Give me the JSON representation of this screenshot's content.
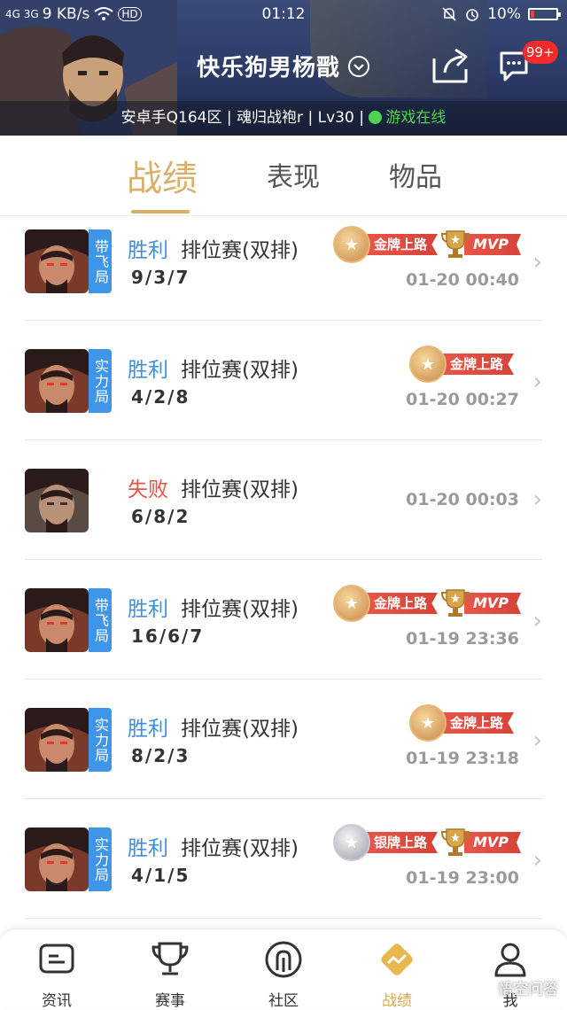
{
  "status_bar": {
    "network": "4G 3G",
    "speed": "9 KB/s",
    "hd": "HD",
    "time": "01:12",
    "battery": "10%"
  },
  "header": {
    "player_name": "快乐狗男杨戬",
    "server": "安卓手Q164区",
    "rank": "魂归战袍r",
    "level": "Lv30",
    "online_status": "游戏在线",
    "message_badge": "99+"
  },
  "tabs": [
    {
      "label": "战绩",
      "active": true
    },
    {
      "label": "表现",
      "active": false
    },
    {
      "label": "物品",
      "active": false
    }
  ],
  "matches": [
    {
      "tag": "带飞局",
      "result": "胜利",
      "mode": "排位赛(双排)",
      "kda": "9/3/7",
      "time": "01-20 00:40",
      "medal": "金牌上路",
      "medal_type": "gold",
      "mvp": "MVP"
    },
    {
      "tag": "实力局",
      "result": "胜利",
      "mode": "排位赛(双排)",
      "kda": "4/2/8",
      "time": "01-20 00:27",
      "medal": "金牌上路",
      "medal_type": "gold",
      "mvp": ""
    },
    {
      "tag": "",
      "result": "失败",
      "mode": "排位赛(双排)",
      "kda": "6/8/2",
      "time": "01-20 00:03",
      "medal": "",
      "medal_type": "",
      "mvp": ""
    },
    {
      "tag": "带飞局",
      "result": "胜利",
      "mode": "排位赛(双排)",
      "kda": "16/6/7",
      "time": "01-19 23:36",
      "medal": "金牌上路",
      "medal_type": "gold",
      "mvp": "MVP"
    },
    {
      "tag": "实力局",
      "result": "胜利",
      "mode": "排位赛(双排)",
      "kda": "8/2/3",
      "time": "01-19 23:18",
      "medal": "金牌上路",
      "medal_type": "gold",
      "mvp": ""
    },
    {
      "tag": "实力局",
      "result": "胜利",
      "mode": "排位赛(双排)",
      "kda": "4/1/5",
      "time": "01-19 23:00",
      "medal": "银牌上路",
      "medal_type": "silver",
      "mvp": "MVP"
    }
  ],
  "bottom_nav": [
    {
      "label": "资讯",
      "icon": "news-icon",
      "active": false
    },
    {
      "label": "赛事",
      "icon": "trophy-icon",
      "active": false
    },
    {
      "label": "社区",
      "icon": "community-icon",
      "active": false
    },
    {
      "label": "战绩",
      "icon": "stats-icon",
      "active": true
    },
    {
      "label": "我",
      "icon": "profile-icon",
      "active": false
    }
  ],
  "watermark": "悟空问答",
  "colors": {
    "accent_gold": "#d8b06a",
    "win_blue": "#3f8fe0",
    "lose_red": "#e2554a",
    "tag_blue": "#3f95e8",
    "online_green": "#4fd24f",
    "badge_red": "#ef2b2b"
  }
}
